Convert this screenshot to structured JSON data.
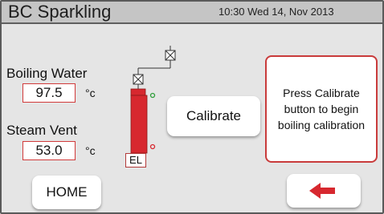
{
  "header": {
    "title": "BC Sparkling",
    "datetime": "10:30 Wed 14, Nov 2013"
  },
  "boiling_water": {
    "label": "Boiling Water",
    "value": "97.5",
    "unit": "°c"
  },
  "steam_vent": {
    "label": "Steam Vent",
    "value": "53.0",
    "unit": "°c"
  },
  "diagram": {
    "element_label": "EL"
  },
  "buttons": {
    "calibrate_label": "Calibrate",
    "home_label": "HOME",
    "back_icon": "left-arrow-icon"
  },
  "message": "Press Calibrate button to begin boiling calibration",
  "colors": {
    "accent_red": "#d7282f",
    "status_green": "#2f9e3a",
    "header_bg": "#c5c5c5",
    "screen_bg": "#e5e5e5"
  }
}
